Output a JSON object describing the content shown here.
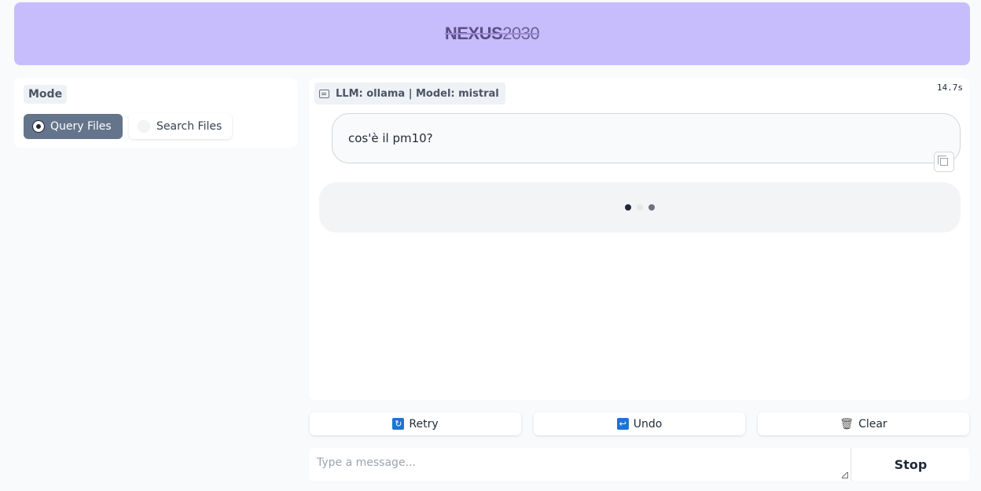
{
  "header": {
    "logo_bold": "NEXUS",
    "logo_light": "2030"
  },
  "mode": {
    "label": "Mode",
    "options": [
      {
        "label": "Query Files",
        "selected": true
      },
      {
        "label": "Search Files",
        "selected": false
      }
    ]
  },
  "chat": {
    "llm_badge": "LLM: ollama | Model: mistral",
    "timer": "14.7s",
    "user_message": "cos'è il pm10?",
    "loading_colors": [
      "#1f2937",
      "#e5e7eb",
      "#6b7280"
    ]
  },
  "actions": {
    "retry_label": "Retry",
    "undo_label": "Undo",
    "clear_label": "Clear"
  },
  "input": {
    "placeholder": "Type a message...",
    "stop_label": "Stop"
  },
  "colors": {
    "header_bg": "#c7bdfd",
    "selected_radio_bg": "#64748b"
  }
}
